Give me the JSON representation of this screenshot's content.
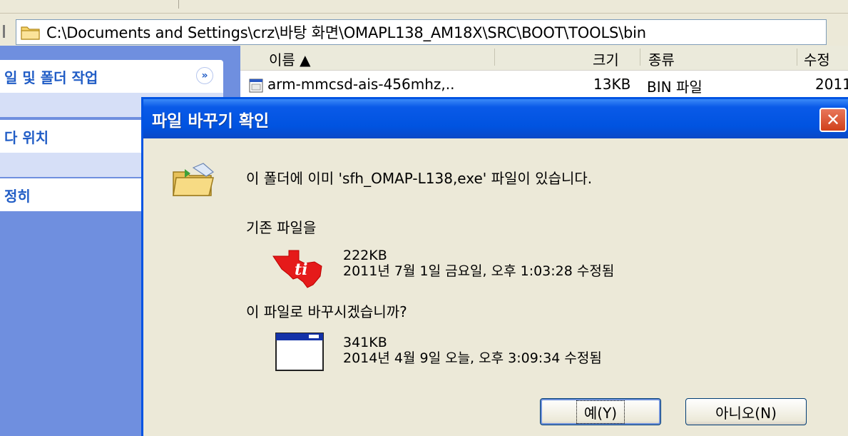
{
  "address": {
    "path": "C:\\Documents and Settings\\crz\\바탕 화면\\OMAPL138_AM18X\\SRC\\BOOT\\TOOLS\\bin"
  },
  "task_pane": {
    "sections": [
      {
        "label": "일 및 폴더 작업"
      },
      {
        "label": "다 위치"
      },
      {
        "label": "정히"
      }
    ]
  },
  "file_list": {
    "columns": [
      "이름 ▲",
      "크기",
      "종류",
      "수정"
    ],
    "rows": [
      {
        "name": "arm-mmcsd-ais-456mhz,..",
        "size": "13KB",
        "type": "BIN 파일",
        "modified": "2011"
      }
    ]
  },
  "dialog": {
    "title": "파일 바꾸기 확인",
    "message": "이 폴더에 이미 'sfh_OMAP-L138,exe' 파일이 있습니다.",
    "existing_label": "기존 파일을",
    "existing_size": "222KB",
    "existing_date": "2011년 7월 1일 금요일, 오후 1:03:28 수정됨",
    "replace_question": "이 파일로 바꾸시겠습니까?",
    "new_size": "341KB",
    "new_date": "2014년 4월 9일 오늘, 오후 3:09:34 수정됨",
    "yes_label": "예(Y)",
    "no_label": "아니오(N)"
  },
  "colors": {
    "titlebar": "#0053e0",
    "task_pane": "#6f8fdf",
    "close_button": "#d0411b"
  }
}
